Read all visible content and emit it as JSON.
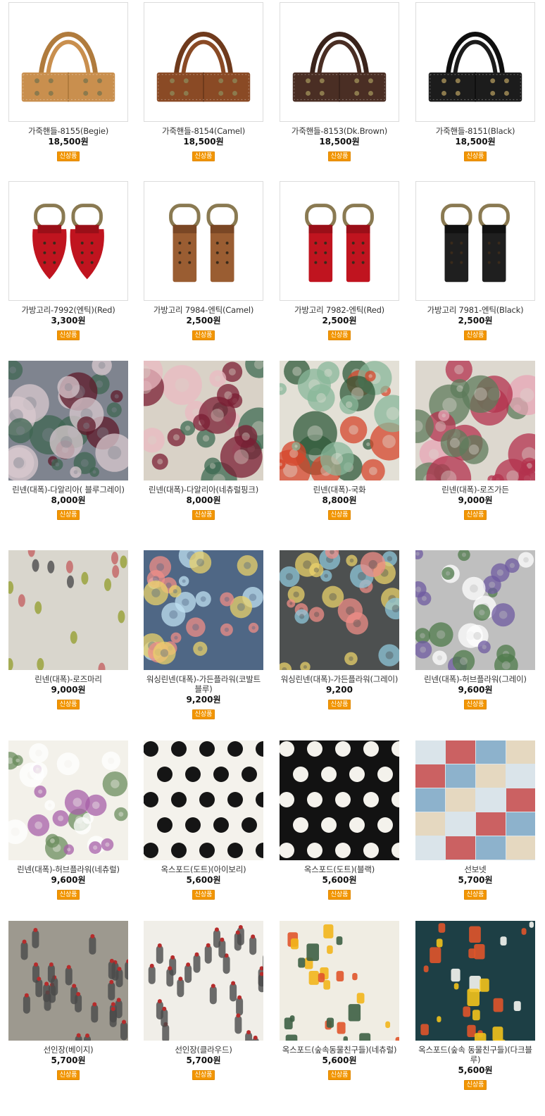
{
  "colors": {
    "badge": "#f29500",
    "border": "#dcdcdc"
  },
  "products": [
    {
      "name": "가죽핸들-8155(Begie)",
      "price": "18,500원",
      "badge": "신상품",
      "image": "handle",
      "colors": [
        "#c98f4e",
        "#b07b3d"
      ]
    },
    {
      "name": "가죽핸들-8154(Camel)",
      "price": "18,500원",
      "badge": "신상품",
      "image": "handle",
      "colors": [
        "#8a4a25",
        "#6f3a1c"
      ]
    },
    {
      "name": "가죽핸들-8153(Dk.Brown)",
      "price": "18,500원",
      "badge": "신상품",
      "image": "handle",
      "colors": [
        "#4a2e24",
        "#3a231b"
      ]
    },
    {
      "name": "가죽핸들-8151(Black)",
      "price": "18,500원",
      "badge": "신상품",
      "image": "handle",
      "colors": [
        "#1c1c1c",
        "#0f0f0f"
      ]
    },
    {
      "name": "가방고리-7992(엔틱)(Red)",
      "price": "3,300원",
      "badge": "신상품",
      "image": "tab-leaf",
      "colors": [
        "#c0141f",
        "#9a0f18"
      ]
    },
    {
      "name": "가방고리 7984-엔틱(Camel)",
      "price": "2,500원",
      "badge": "신상품",
      "image": "tab",
      "colors": [
        "#9a5d32",
        "#7a4725"
      ]
    },
    {
      "name": "가방고리 7982-엔틱(Red)",
      "price": "2,500원",
      "badge": "신상품",
      "image": "tab",
      "colors": [
        "#c0141f",
        "#9a0f18"
      ]
    },
    {
      "name": "가방고리 7981-엔틱(Black)",
      "price": "2,500원",
      "badge": "신상품",
      "image": "tab",
      "colors": [
        "#1f1f1f",
        "#111111"
      ]
    },
    {
      "name": "린넨(대폭)-다알리아( 블루그레이)",
      "price": "8,000원",
      "badge": "신상품",
      "image": "floral",
      "colors": [
        "#7f848f",
        "#5e1a2a",
        "#d9c9cf",
        "#3f6651"
      ]
    },
    {
      "name": "린넨(대폭)-다알리아(네츄럴핑크)",
      "price": "8,000원",
      "badge": "신상품",
      "image": "floral",
      "colors": [
        "#d9d2c7",
        "#7a1e33",
        "#e9b9c1",
        "#3c6a52"
      ]
    },
    {
      "name": "린넨(대폭)-국화",
      "price": "8,800원",
      "badge": "신상품",
      "image": "chrysanthemum",
      "colors": [
        "#e3e0d6",
        "#2f5a3a",
        "#d5452b",
        "#88b79a"
      ]
    },
    {
      "name": "린넨(대폭)-로즈가든",
      "price": "9,000원",
      "badge": "신상품",
      "image": "rose",
      "colors": [
        "#ddd8cf",
        "#b3324d",
        "#e7a5b5",
        "#5d7b5b"
      ]
    },
    {
      "name": "린넨(대폭)-로즈마리",
      "price": "9,000원",
      "badge": "신상품",
      "image": "rosemary",
      "colors": [
        "#d9d6cd",
        "#9aa33d",
        "#555555",
        "#c46a6a"
      ]
    },
    {
      "name": "워싱린넨(대폭)-가든플라워(코발트블루)",
      "price": "9,200원",
      "badge": "신상품",
      "image": "garden",
      "colors": [
        "#4f6785",
        "#ef8e87",
        "#e9d26b",
        "#bfe0f2"
      ]
    },
    {
      "name": "워싱린넨(대폭)-가든플라워(그레이)",
      "price": "9,200",
      "badge": "신상품",
      "image": "garden",
      "colors": [
        "#4d5050",
        "#ef8e87",
        "#e9d26b",
        "#8fc7d9"
      ]
    },
    {
      "name": "린넨(대폭)-허브플라워(그레이)",
      "price": "9,600원",
      "badge": "신상품",
      "image": "herb",
      "colors": [
        "#bfbfbf",
        "#6e5aa0",
        "#ffffff",
        "#4d7a4a"
      ]
    },
    {
      "name": "린넨(대폭)-허브플라워(네츄럴)",
      "price": "9,600원",
      "badge": "신상품",
      "image": "herb",
      "colors": [
        "#f3f1ea",
        "#a75fa8",
        "#ffffff",
        "#6b8c5e"
      ]
    },
    {
      "name": "옥스포드(도트)(아이보리)",
      "price": "5,600원",
      "badge": "신상품",
      "image": "dots",
      "colors": [
        "#f4f2ec",
        "#151515"
      ]
    },
    {
      "name": "옥스포드(도트)(블랙)",
      "price": "5,600원",
      "badge": "신상품",
      "image": "dots",
      "colors": [
        "#121212",
        "#f4f2ec"
      ]
    },
    {
      "name": "선보넷",
      "price": "5,700원",
      "badge": "신상품",
      "image": "patchwork",
      "colors": [
        "#d9e4ea",
        "#c84a4a",
        "#7fa9c7",
        "#e6d6b8"
      ]
    },
    {
      "name": "선인장(베이지)",
      "price": "5,700원",
      "badge": "신상품",
      "image": "cactus",
      "colors": [
        "#9d998f",
        "#e9e6dc",
        "#b62c2c",
        "#4a4a4a"
      ]
    },
    {
      "name": "선인장(클라우드)",
      "price": "5,700원",
      "badge": "신상품",
      "image": "cactus",
      "colors": [
        "#f0eee8",
        "#cfcac0",
        "#b62c2c",
        "#4a4a4a"
      ]
    },
    {
      "name": "옥스포드(숲속동물친구들)(네츄럴)",
      "price": "5,600원",
      "badge": "신상품",
      "image": "animals",
      "colors": [
        "#f0ede3",
        "#f2b51b",
        "#e0542a",
        "#3d5f44"
      ]
    },
    {
      "name": "옥스포드(숲속 동물친구들)(다크블루)",
      "price": "5,600원",
      "badge": "신상품",
      "image": "animals",
      "colors": [
        "#1d3f45",
        "#f2c21b",
        "#e0542a",
        "#f5f5f0"
      ]
    }
  ]
}
